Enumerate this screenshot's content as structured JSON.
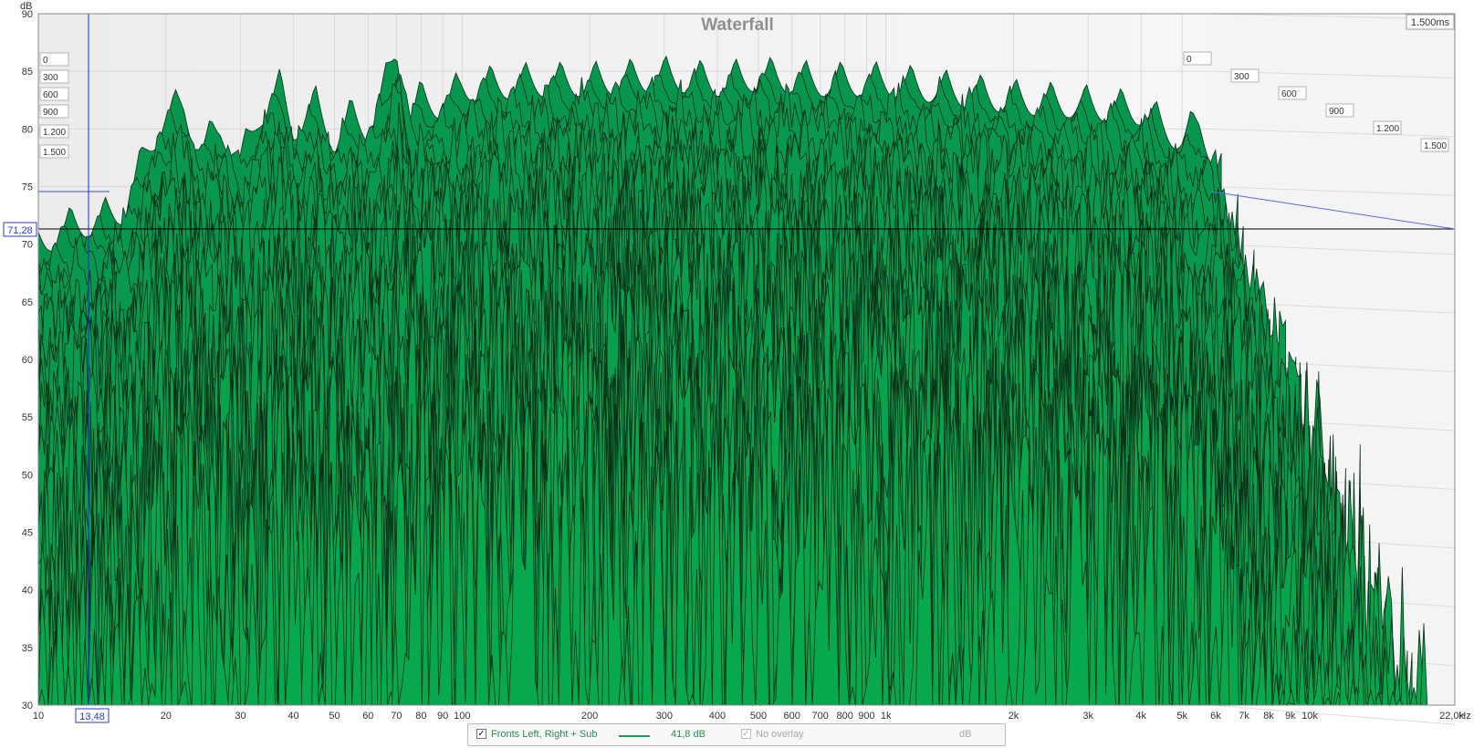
{
  "chart_data": {
    "type": "area",
    "title": "Waterfall",
    "ylabel": "dB",
    "xlabel": "Hz",
    "ylim": [
      30,
      90
    ],
    "xlim": [
      10,
      22000
    ],
    "x_scale": "log",
    "y_ticks": [
      30,
      35,
      40,
      45,
      50,
      55,
      60,
      65,
      70,
      75,
      80,
      85,
      90
    ],
    "x_ticks": [
      {
        "value": 10,
        "label": "10"
      },
      {
        "value": 20,
        "label": "20"
      },
      {
        "value": 30,
        "label": "30"
      },
      {
        "value": 40,
        "label": "40"
      },
      {
        "value": 50,
        "label": "50"
      },
      {
        "value": 60,
        "label": "60"
      },
      {
        "value": 70,
        "label": "70"
      },
      {
        "value": 80,
        "label": "80"
      },
      {
        "value": 90,
        "label": "90"
      },
      {
        "value": 100,
        "label": "100"
      },
      {
        "value": 200,
        "label": "200"
      },
      {
        "value": 300,
        "label": "300"
      },
      {
        "value": 400,
        "label": "400"
      },
      {
        "value": 500,
        "label": "500"
      },
      {
        "value": 600,
        "label": "600"
      },
      {
        "value": 700,
        "label": "700"
      },
      {
        "value": 800,
        "label": "800"
      },
      {
        "value": 900,
        "label": "900"
      },
      {
        "value": 1000,
        "label": "1k"
      },
      {
        "value": 2000,
        "label": "2k"
      },
      {
        "value": 3000,
        "label": "3k"
      },
      {
        "value": 4000,
        "label": "4k"
      },
      {
        "value": 5000,
        "label": "5k"
      },
      {
        "value": 6000,
        "label": "6k"
      },
      {
        "value": 7000,
        "label": "7k"
      },
      {
        "value": 8000,
        "label": "8k"
      },
      {
        "value": 9000,
        "label": "9k"
      },
      {
        "value": 10000,
        "label": "10k"
      },
      {
        "value": 22000,
        "label": "22,0k"
      }
    ],
    "time_slice_labels": [
      "0",
      "300",
      "600",
      "900",
      "1.200",
      "1.500"
    ],
    "time_span_label": "1.500ms",
    "cursor": {
      "x_label": "13,48",
      "y_label": "71,28"
    },
    "grid": true,
    "fill_color": "#0aa14f",
    "envelope": {
      "x": [
        10,
        12,
        14,
        16,
        18,
        20,
        22,
        24,
        27,
        30,
        33,
        37,
        40,
        45,
        50,
        55,
        60,
        65,
        70,
        75,
        80,
        90,
        100,
        150,
        200,
        300,
        400,
        500,
        700,
        1000,
        2000,
        3000,
        4000,
        5000,
        5500,
        6000
      ],
      "y": [
        72,
        73.5,
        74,
        75,
        80,
        83,
        84,
        80,
        82,
        79,
        83,
        85.5,
        82,
        84,
        81,
        83,
        82,
        85,
        89,
        83,
        84.5,
        84,
        85.5,
        86,
        86,
        86.5,
        86,
        86.5,
        86,
        86,
        84.5,
        84,
        83.5,
        81,
        82.5,
        79
      ]
    },
    "legend": {
      "series_name": "Fronts Left, Right + Sub",
      "series_value": "41,8 dB",
      "overlay_label": "No overlay",
      "overlay_unit": "dB"
    }
  }
}
